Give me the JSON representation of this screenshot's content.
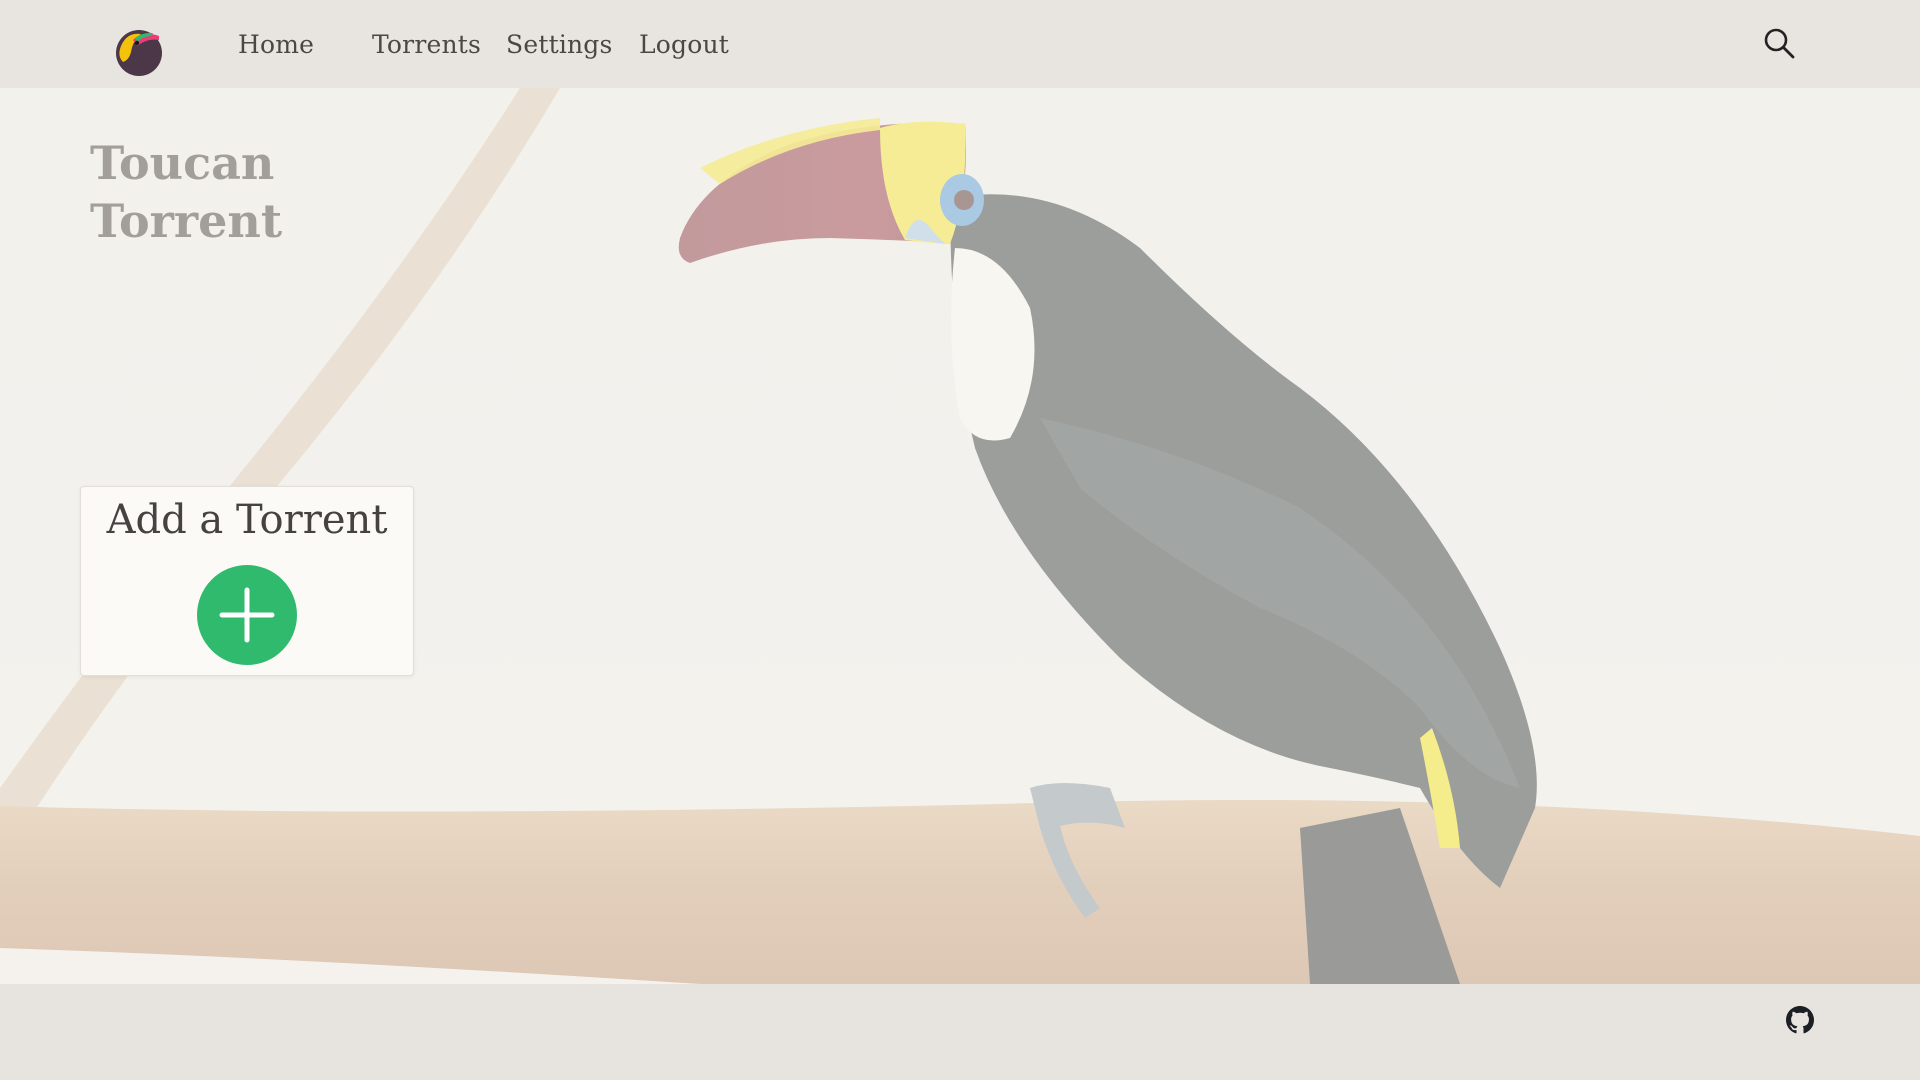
{
  "nav": {
    "home": "Home",
    "torrents": "Torrents",
    "settings": "Settings",
    "logout": "Logout"
  },
  "hero": {
    "title_line1": "Toucan",
    "title_line2": "Torrent"
  },
  "add_card": {
    "title": "Add a Torrent"
  },
  "colors": {
    "accent_green": "#2fba6e",
    "header_bg": "#e8e5e0",
    "title_gray": "#a29f9b",
    "text_dark": "#4a4745"
  },
  "icons": {
    "logo": "toucan-logo-icon",
    "search": "search-icon",
    "add": "plus-icon",
    "footer": "github-icon"
  }
}
